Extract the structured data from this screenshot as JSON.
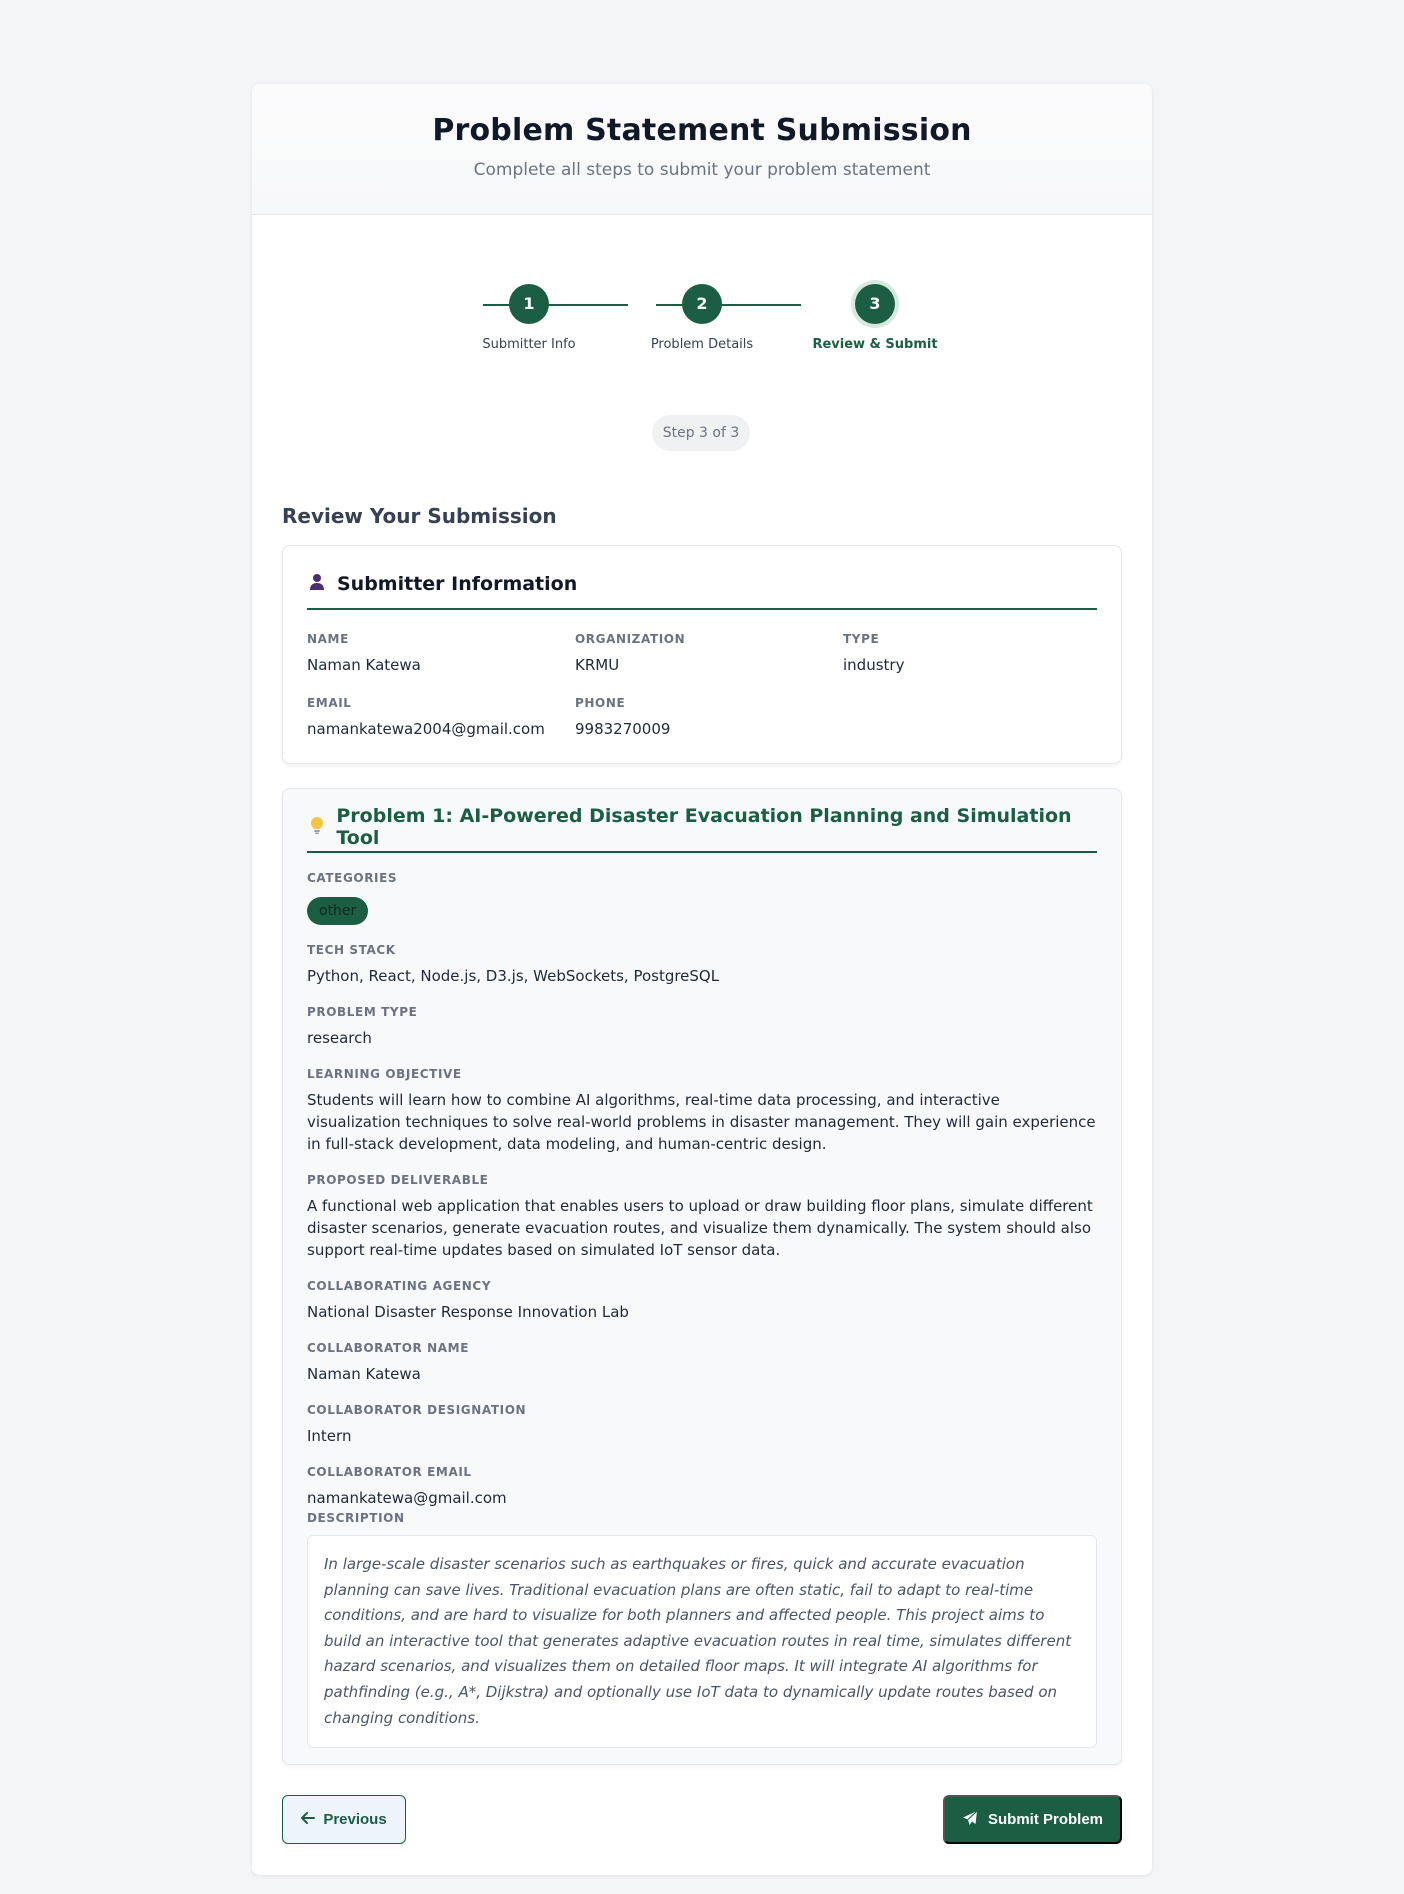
{
  "header": {
    "title": "Problem Statement Submission",
    "subtitle": "Complete all steps to submit your problem statement"
  },
  "stepper": {
    "steps": [
      {
        "number": "1",
        "label": "Submitter Info"
      },
      {
        "number": "2",
        "label": "Problem Details"
      },
      {
        "number": "3",
        "label": "Review & Submit"
      }
    ],
    "active_step": 3,
    "progress_text": "Step 3 of 3"
  },
  "review": {
    "title": "Review Your Submission",
    "submitter": {
      "heading": "Submitter Information",
      "icon": "user-icon",
      "fields": {
        "name": {
          "label": "Name",
          "value": "Naman Katewa"
        },
        "organization": {
          "label": "Organization",
          "value": "KRMU"
        },
        "type": {
          "label": "Type",
          "value": "industry"
        },
        "email": {
          "label": "Email",
          "value": "namankatewa2004@gmail.com"
        },
        "phone": {
          "label": "Phone",
          "value": "9983270009"
        }
      }
    },
    "problem": {
      "heading": "Problem 1: AI-Powered Disaster Evacuation Planning and Simulation Tool",
      "icon": "lightbulb-icon",
      "categories_label": "Categories",
      "categories": [
        "other"
      ],
      "tech_stack": {
        "label": "Tech Stack",
        "value": "Python, React, Node.js, D3.js, WebSockets, PostgreSQL"
      },
      "problem_type": {
        "label": "Problem Type",
        "value": "research"
      },
      "learning_objective": {
        "label": "Learning Objective",
        "value": "Students will learn how to combine AI algorithms, real-time data processing, and interactive visualization techniques to solve real-world problems in disaster management. They will gain experience in full-stack development, data modeling, and human-centric design."
      },
      "proposed_deliverable": {
        "label": "Proposed Deliverable",
        "value": "A functional web application that enables users to upload or draw building floor plans, simulate different disaster scenarios, generate evacuation routes, and visualize them dynamically. The system should also support real-time updates based on simulated IoT sensor data."
      },
      "collaborating_agency": {
        "label": "Collaborating Agency",
        "value": "National Disaster Response Innovation Lab"
      },
      "collaborator_name": {
        "label": "Collaborator Name",
        "value": "Naman Katewa"
      },
      "collaborator_designation": {
        "label": "Collaborator Designation",
        "value": "Intern"
      },
      "collaborator_email": {
        "label": "Collaborator Email",
        "value": "namankatewa@gmail.com"
      },
      "description": {
        "label": "Description",
        "value": "In large-scale disaster scenarios such as earthquakes or fires, quick and accurate evacuation planning can save lives. Traditional evacuation plans are often static, fail to adapt to real-time conditions, and are hard to visualize for both planners and affected people. This project aims to build an interactive tool that generates adaptive evacuation routes in real time, simulates different hazard scenarios, and visualizes them on detailed floor maps. It will integrate AI algorithms for pathfinding (e.g., A*, Dijkstra) and optionally use IoT data to dynamically update routes based on changing conditions."
      }
    }
  },
  "actions": {
    "previous_label": "Previous",
    "submit_label": "Submit Problem"
  },
  "colors": {
    "accent": "#1b5e43",
    "background": "#f4f5f7"
  }
}
